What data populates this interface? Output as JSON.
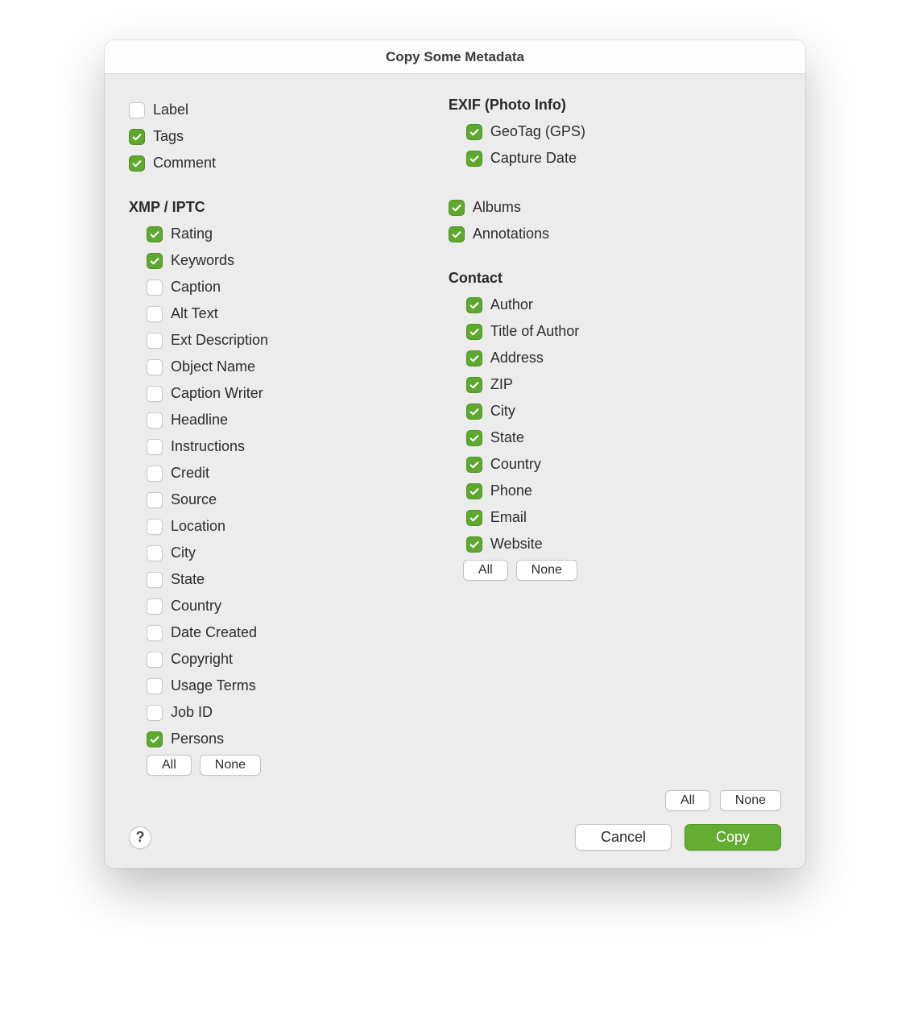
{
  "dialog": {
    "title": "Copy Some Metadata"
  },
  "leftColumn": {
    "topItems": [
      {
        "name": "label",
        "label": "Label",
        "checked": false
      },
      {
        "name": "tags",
        "label": "Tags",
        "checked": true
      },
      {
        "name": "comment",
        "label": "Comment",
        "checked": true
      }
    ],
    "xmpHeading": "XMP / IPTC",
    "xmpItems": [
      {
        "name": "rating",
        "label": "Rating",
        "checked": true
      },
      {
        "name": "keywords",
        "label": "Keywords",
        "checked": true
      },
      {
        "name": "caption",
        "label": "Caption",
        "checked": false
      },
      {
        "name": "alt-text",
        "label": "Alt Text",
        "checked": false
      },
      {
        "name": "ext-description",
        "label": "Ext Description",
        "checked": false
      },
      {
        "name": "object-name",
        "label": "Object Name",
        "checked": false
      },
      {
        "name": "caption-writer",
        "label": "Caption Writer",
        "checked": false
      },
      {
        "name": "headline",
        "label": "Headline",
        "checked": false
      },
      {
        "name": "instructions",
        "label": "Instructions",
        "checked": false
      },
      {
        "name": "credit",
        "label": "Credit",
        "checked": false
      },
      {
        "name": "source",
        "label": "Source",
        "checked": false
      },
      {
        "name": "location",
        "label": "Location",
        "checked": false
      },
      {
        "name": "city",
        "label": "City",
        "checked": false
      },
      {
        "name": "state",
        "label": "State",
        "checked": false
      },
      {
        "name": "country",
        "label": "Country",
        "checked": false
      },
      {
        "name": "date-created",
        "label": "Date Created",
        "checked": false
      },
      {
        "name": "copyright",
        "label": "Copyright",
        "checked": false
      },
      {
        "name": "usage-terms",
        "label": "Usage Terms",
        "checked": false
      },
      {
        "name": "job-id",
        "label": "Job ID",
        "checked": false
      },
      {
        "name": "persons",
        "label": "Persons",
        "checked": true
      }
    ],
    "allLabel": "All",
    "noneLabel": "None"
  },
  "rightColumn": {
    "exifHeading": "EXIF (Photo Info)",
    "exifItems": [
      {
        "name": "geotag",
        "label": "GeoTag (GPS)",
        "checked": true
      },
      {
        "name": "capture-date",
        "label": "Capture Date",
        "checked": true
      }
    ],
    "miscItems": [
      {
        "name": "albums",
        "label": "Albums",
        "checked": true
      },
      {
        "name": "annotations",
        "label": "Annotations",
        "checked": true
      }
    ],
    "contactHeading": "Contact",
    "contactItems": [
      {
        "name": "author",
        "label": "Author",
        "checked": true
      },
      {
        "name": "title-of-author",
        "label": "Title of Author",
        "checked": true
      },
      {
        "name": "address",
        "label": "Address",
        "checked": true
      },
      {
        "name": "zip",
        "label": "ZIP",
        "checked": true
      },
      {
        "name": "contact-city",
        "label": "City",
        "checked": true
      },
      {
        "name": "contact-state",
        "label": "State",
        "checked": true
      },
      {
        "name": "contact-country",
        "label": "Country",
        "checked": true
      },
      {
        "name": "phone",
        "label": "Phone",
        "checked": true
      },
      {
        "name": "email",
        "label": "Email",
        "checked": true
      },
      {
        "name": "website",
        "label": "Website",
        "checked": true
      }
    ],
    "allLabel": "All",
    "noneLabel": "None"
  },
  "footer": {
    "globalAllLabel": "All",
    "globalNoneLabel": "None",
    "helpLabel": "?",
    "cancelLabel": "Cancel",
    "copyLabel": "Copy"
  }
}
